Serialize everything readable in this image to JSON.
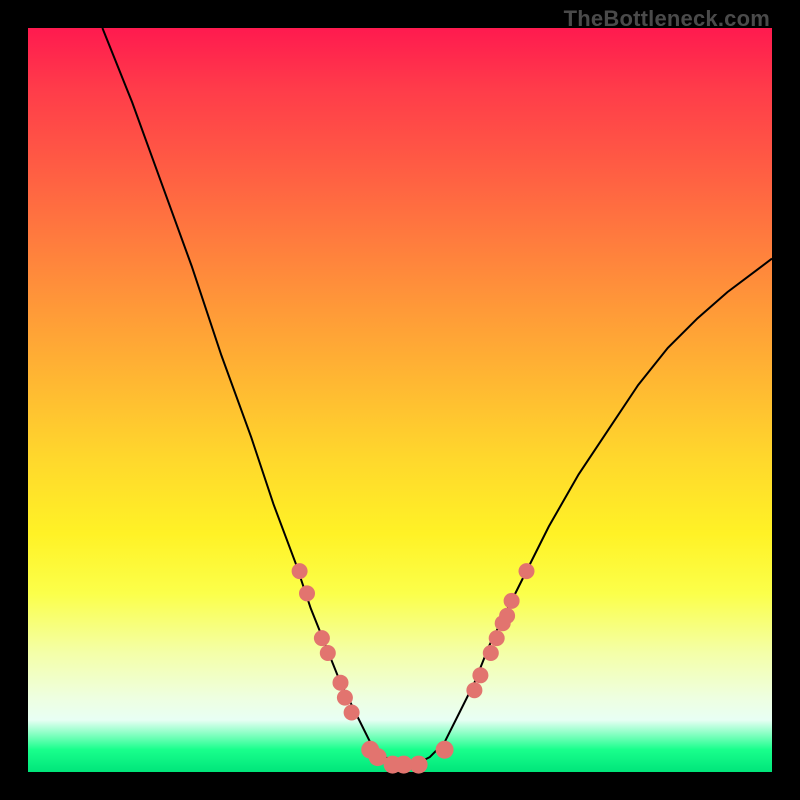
{
  "watermark": "TheBottleneck.com",
  "colors": {
    "background_border": "#000000",
    "curve": "#000000",
    "marker": "#e2746f",
    "gradient_top": "#ff1a4f",
    "gradient_bottom": "#00e57a"
  },
  "chart_data": {
    "type": "line",
    "title": "",
    "xlabel": "",
    "ylabel": "",
    "xlim": [
      0,
      100
    ],
    "ylim": [
      0,
      100
    ],
    "series": [
      {
        "name": "bottleneck-curve",
        "x": [
          10,
          14,
          18,
          22,
          26,
          30,
          33,
          36,
          38,
          40,
          42,
          44,
          46,
          48,
          50,
          52,
          54,
          56,
          58,
          60,
          62,
          66,
          70,
          74,
          78,
          82,
          86,
          90,
          94,
          98,
          100
        ],
        "y": [
          100,
          90,
          79,
          68,
          56,
          45,
          36,
          28,
          22,
          17,
          12,
          8,
          4,
          2,
          1,
          1,
          2,
          4,
          8,
          12,
          17,
          25,
          33,
          40,
          46,
          52,
          57,
          61,
          64.5,
          67.5,
          69
        ]
      }
    ],
    "markers": [
      {
        "x": 36.5,
        "y": 27
      },
      {
        "x": 37.5,
        "y": 24
      },
      {
        "x": 39.5,
        "y": 18
      },
      {
        "x": 40.3,
        "y": 16
      },
      {
        "x": 42.0,
        "y": 12
      },
      {
        "x": 42.6,
        "y": 10
      },
      {
        "x": 43.5,
        "y": 8
      },
      {
        "x": 46.0,
        "y": 3
      },
      {
        "x": 47.0,
        "y": 2
      },
      {
        "x": 49.0,
        "y": 1
      },
      {
        "x": 50.5,
        "y": 1
      },
      {
        "x": 52.5,
        "y": 1
      },
      {
        "x": 56.0,
        "y": 3
      },
      {
        "x": 60.0,
        "y": 11
      },
      {
        "x": 60.8,
        "y": 13
      },
      {
        "x": 62.2,
        "y": 16
      },
      {
        "x": 63.0,
        "y": 18
      },
      {
        "x": 63.8,
        "y": 20
      },
      {
        "x": 64.4,
        "y": 21
      },
      {
        "x": 65.0,
        "y": 23
      },
      {
        "x": 67.0,
        "y": 27
      }
    ],
    "marker_radius_px": 8
  }
}
